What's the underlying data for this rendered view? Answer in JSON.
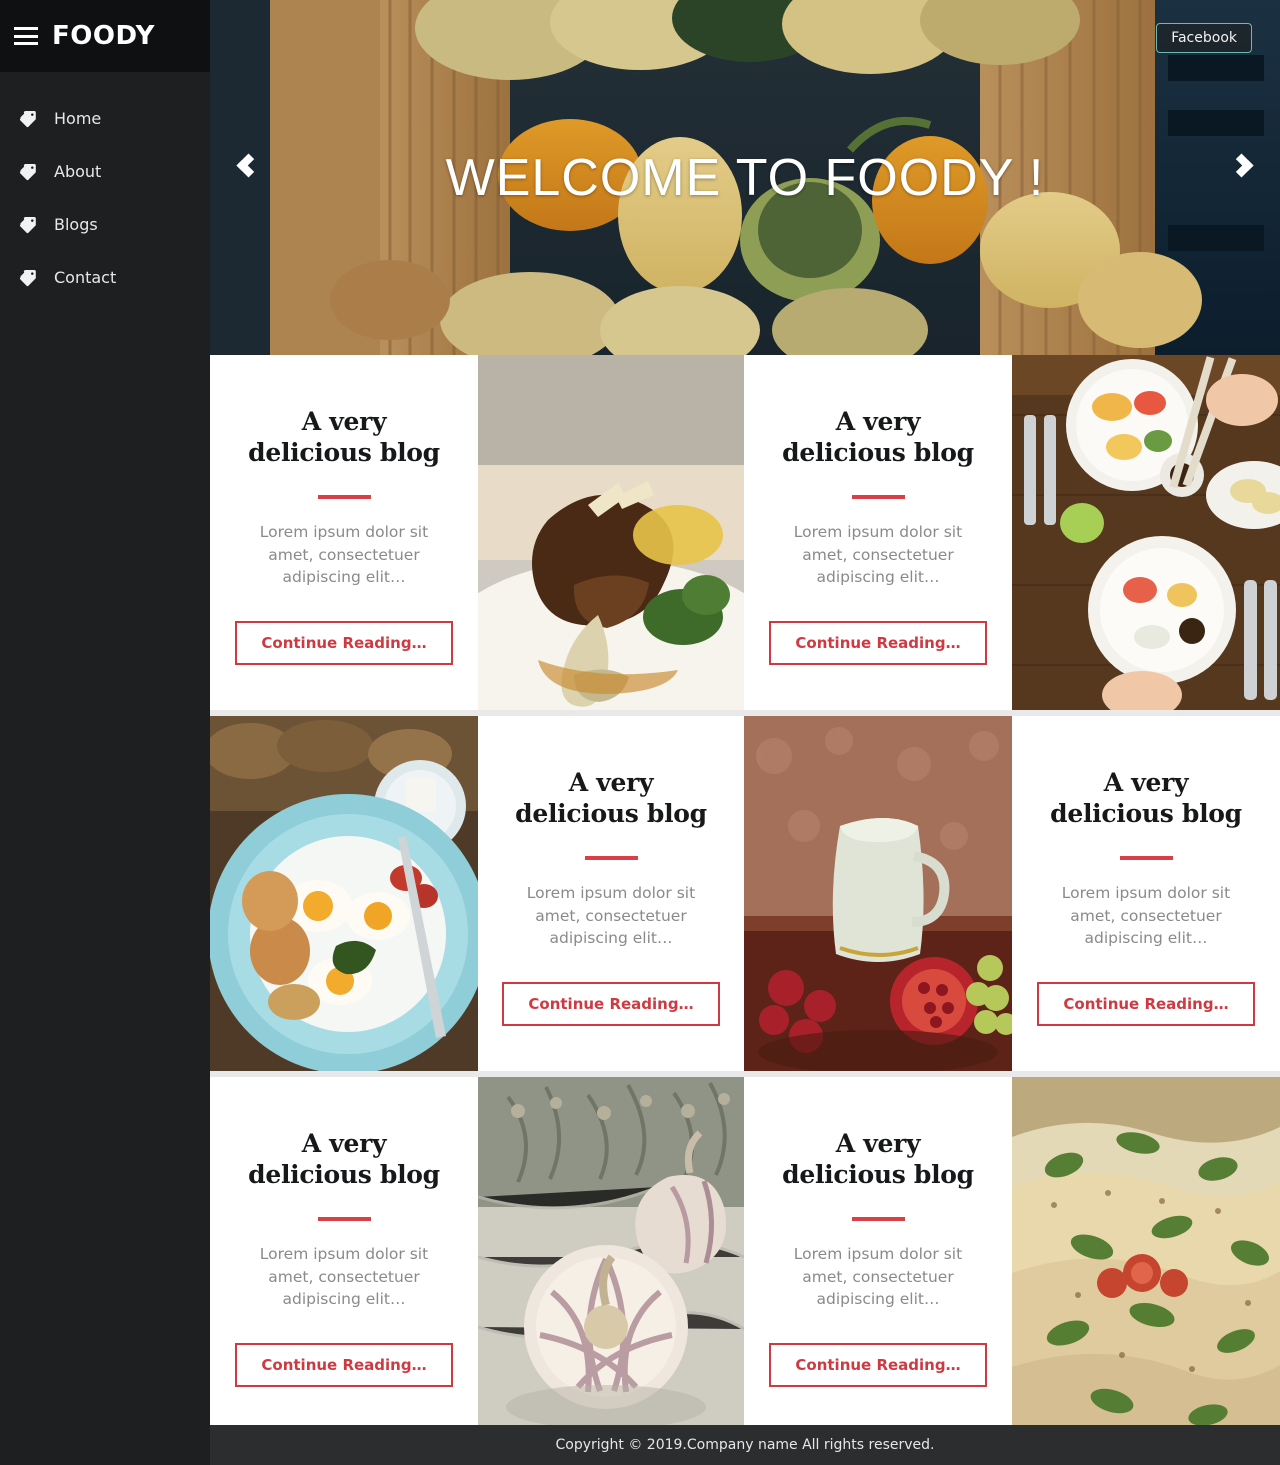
{
  "sidebar": {
    "brand": "FOODY",
    "menu_icon": "hamburger-icon",
    "items": [
      {
        "label": "Home",
        "icon": "tags-icon"
      },
      {
        "label": "About",
        "icon": "tags-icon"
      },
      {
        "label": "Blogs",
        "icon": "tags-icon"
      },
      {
        "label": "Contact",
        "icon": "tags-icon"
      }
    ]
  },
  "hero": {
    "title": "WELCOME TO FOODY !",
    "prev_icon": "chevron-left-icon",
    "next_icon": "chevron-right-icon",
    "facebook_label": "Facebook",
    "image_alt": "basket of gourds and squash"
  },
  "blog": {
    "card": {
      "title_line1": "A very",
      "title_line2": "delicious blog",
      "excerpt": "Lorem ipsum dolor sit amet, consectetuer adipiscing elit…",
      "button_label": "Continue Reading…"
    },
    "cells": [
      {
        "type": "text",
        "photo_alt": ""
      },
      {
        "type": "photo",
        "photo_alt": "braised lamb shank on plate"
      },
      {
        "type": "text",
        "photo_alt": ""
      },
      {
        "type": "photo",
        "photo_alt": "sushi and breakfast plates on table"
      },
      {
        "type": "photo",
        "photo_alt": "fried eggs and bacon on blue plate"
      },
      {
        "type": "text",
        "photo_alt": ""
      },
      {
        "type": "photo",
        "photo_alt": "pitcher with pomegranate and grapes"
      },
      {
        "type": "text",
        "photo_alt": ""
      },
      {
        "type": "text",
        "photo_alt": ""
      },
      {
        "type": "photo",
        "photo_alt": "garlic bulbs on marble"
      },
      {
        "type": "text",
        "photo_alt": ""
      },
      {
        "type": "photo",
        "photo_alt": "baked fish with herbs and tomato"
      }
    ]
  },
  "footer": {
    "copyright": "Copyright © 2019.Company name All rights reserved."
  },
  "colors": {
    "accent_red": "#d93f46",
    "button_red": "#cf3a42",
    "sidebar_bg": "#1d1f20",
    "sidebar_header_bg": "#0f1011",
    "footer_bg": "#2b2d2f",
    "facebook_border": "#6fb6b6"
  }
}
